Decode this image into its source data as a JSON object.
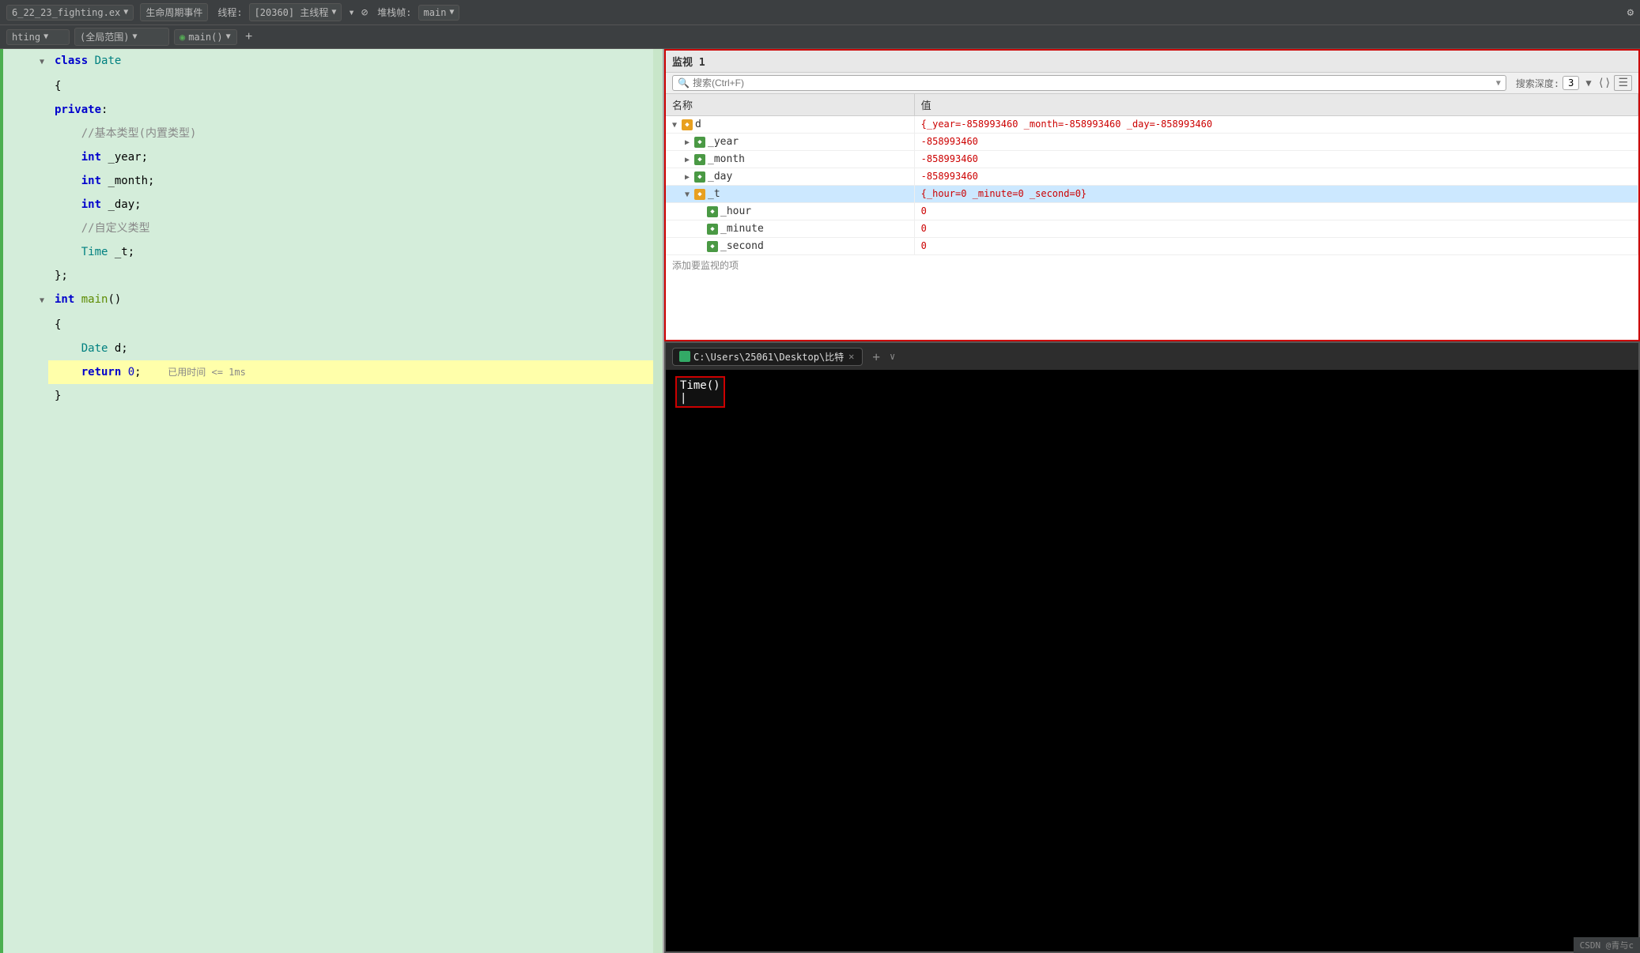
{
  "toolbar": {
    "file_label": "6_22_23_fighting.ex",
    "lifecycle_label": "生命周期事件",
    "thread_label": "线程:",
    "thread_id": "[20360] 主线程",
    "stack_label": "堆栈帧:",
    "stack_value": "main",
    "gear_icon": "⚙"
  },
  "breadcrumb": {
    "file": "hting",
    "scope": "(全局范围)",
    "func": "main()",
    "add_icon": "+"
  },
  "watch": {
    "title": "监视 1",
    "search_placeholder": "搜索(Ctrl+F)",
    "search_depth_label": "搜索深度:",
    "search_depth_value": "3",
    "col_name": "名称",
    "col_value": "值",
    "rows": [
      {
        "indent": 0,
        "expanded": true,
        "icon": "◆",
        "icon_color": "orange",
        "name": "d",
        "value": "{_year=-858993460 _month=-858993460 _day=-858993460",
        "selected": false
      },
      {
        "indent": 1,
        "expanded": false,
        "icon": "◆",
        "icon_color": "green",
        "name": "_year",
        "value": "-858993460",
        "selected": false
      },
      {
        "indent": 1,
        "expanded": false,
        "icon": "◆",
        "icon_color": "green",
        "name": "_month",
        "value": "-858993460",
        "selected": false
      },
      {
        "indent": 1,
        "expanded": false,
        "icon": "◆",
        "icon_color": "green",
        "name": "_day",
        "value": "-858993460",
        "selected": false
      },
      {
        "indent": 1,
        "expanded": true,
        "icon": "◆",
        "icon_color": "orange",
        "name": "_t",
        "value": "{_hour=0 _minute=0 _second=0}",
        "selected": true
      },
      {
        "indent": 2,
        "expanded": false,
        "icon": "◆",
        "icon_color": "green",
        "name": "_hour",
        "value": "0",
        "selected": false
      },
      {
        "indent": 2,
        "expanded": false,
        "icon": "◆",
        "icon_color": "green",
        "name": "_minute",
        "value": "0",
        "selected": false
      },
      {
        "indent": 2,
        "expanded": false,
        "icon": "◆",
        "icon_color": "green",
        "name": "_second",
        "value": "0",
        "selected": false
      }
    ],
    "add_watch_label": "添加要监视的项"
  },
  "code": {
    "lines": [
      {
        "num": "",
        "fold": "▼",
        "text": "class Date",
        "indent": 0
      },
      {
        "num": "",
        "fold": " ",
        "text": "{",
        "indent": 0
      },
      {
        "num": "",
        "fold": " ",
        "text": "private:",
        "indent": 0
      },
      {
        "num": "",
        "fold": " ",
        "text": "    //基本类型(内置类型)",
        "indent": 0
      },
      {
        "num": "",
        "fold": " ",
        "text": "    int _year;",
        "indent": 0
      },
      {
        "num": "",
        "fold": " ",
        "text": "    int _month;",
        "indent": 0
      },
      {
        "num": "",
        "fold": " ",
        "text": "    int _day;",
        "indent": 0
      },
      {
        "num": "",
        "fold": " ",
        "text": "    //自定义类型",
        "indent": 0
      },
      {
        "num": "",
        "fold": " ",
        "text": "    Time _t;",
        "indent": 0
      },
      {
        "num": "",
        "fold": " ",
        "text": "};",
        "indent": 0
      },
      {
        "num": "",
        "fold": "▼",
        "text": "int main()",
        "indent": 0
      },
      {
        "num": "",
        "fold": " ",
        "text": "{",
        "indent": 0
      },
      {
        "num": "",
        "fold": " ",
        "text": "    Date d;",
        "indent": 0
      },
      {
        "num": "",
        "fold": " ",
        "text": "    return 0;",
        "indent": 0,
        "tooltip": "已用时间 <= 1ms"
      },
      {
        "num": "",
        "fold": " ",
        "text": "}",
        "indent": 0
      }
    ]
  },
  "terminal": {
    "tab_label": "C:\\Users\\25061\\Desktop\\比特",
    "close_icon": "✕",
    "add_icon": "+",
    "dropdown_icon": "∨",
    "output": "Time()",
    "cursor": "|"
  },
  "statusbar": {
    "label": "CSDN @青与c"
  }
}
